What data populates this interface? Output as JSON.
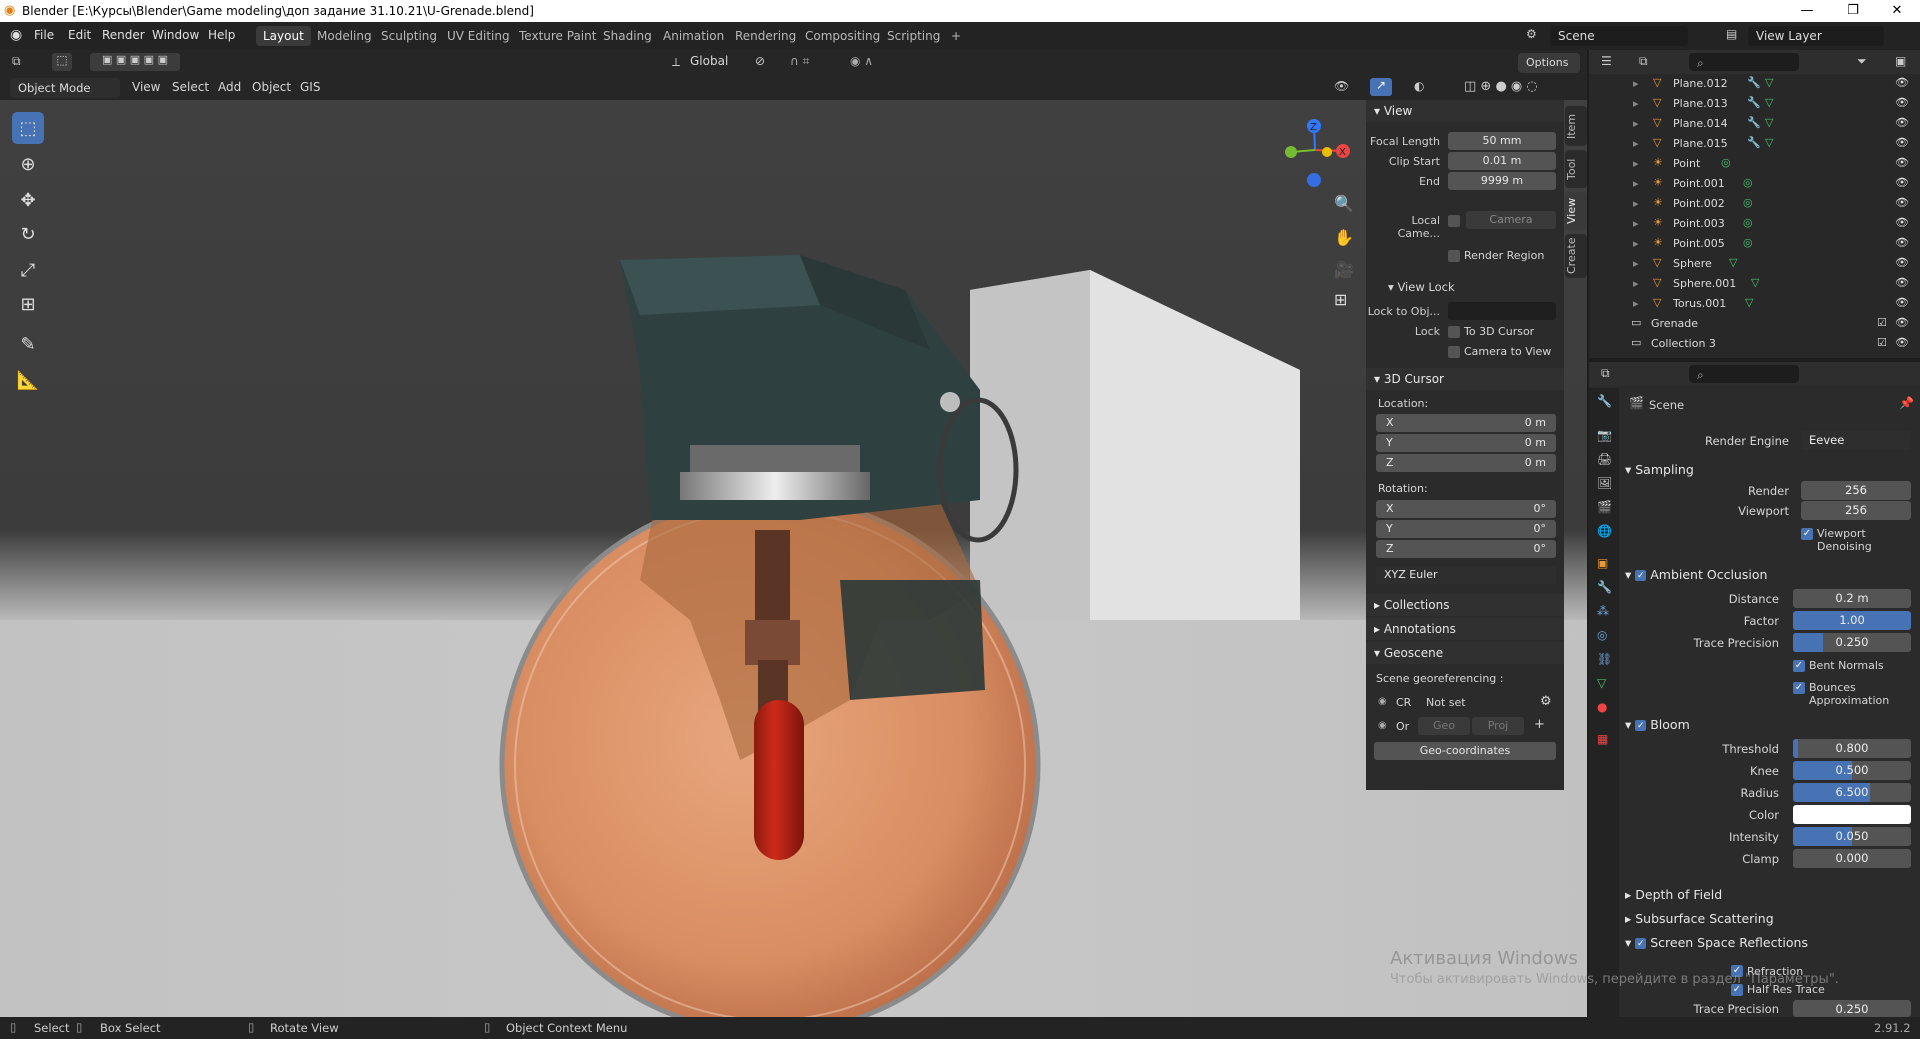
{
  "window": {
    "title": "Blender [E:\\Курсы\\Blender\\Game modeling\\доп задание 31.10.21\\U-Grenade.blend]",
    "minimize": "—",
    "maximize": "❐",
    "close": "✕"
  },
  "menus": [
    "File",
    "Edit",
    "Render",
    "Window",
    "Help"
  ],
  "workspaces": [
    "Layout",
    "Modeling",
    "Sculpting",
    "UV Editing",
    "Texture Paint",
    "Shading",
    "Animation",
    "Rendering",
    "Compositing",
    "Scripting"
  ],
  "workspace_add": "+",
  "scene": {
    "name": "Scene",
    "view_layer": "View Layer"
  },
  "viewport_header": {
    "transform": "Global",
    "options": "Options",
    "mode": "Object Mode",
    "menus": [
      "View",
      "Select",
      "Add",
      "Object",
      "GIS"
    ]
  },
  "npanel": {
    "tabs": [
      "Item",
      "Tool",
      "View",
      "Create"
    ],
    "view": {
      "title": "View",
      "focal_label": "Focal Length",
      "focal": "50 mm",
      "clip_start_label": "Clip Start",
      "clip_start": "0.01 m",
      "end_label": "End",
      "end": "9999 m",
      "local_cam_label": "Local Came...",
      "camera": "Camera",
      "render_region": "Render Region"
    },
    "view_lock": {
      "title": "View Lock",
      "lock_obj_label": "Lock to Obj...",
      "lock_label": "Lock",
      "to_cursor": "To 3D Cursor",
      "cam_to_view": "Camera to View"
    },
    "cursor": {
      "title": "3D Cursor",
      "location_label": "Location:",
      "loc": [
        {
          "axis": "X",
          "value": "0 m"
        },
        {
          "axis": "Y",
          "value": "0 m"
        },
        {
          "axis": "Z",
          "value": "0 m"
        }
      ],
      "rotation_label": "Rotation:",
      "rot": [
        {
          "axis": "X",
          "value": "0°"
        },
        {
          "axis": "Y",
          "value": "0°"
        },
        {
          "axis": "Z",
          "value": "0°"
        }
      ],
      "mode": "XYZ Euler"
    },
    "collections": "Collections",
    "annotations": "Annotations",
    "geoscene": {
      "title": "Geoscene",
      "georef": "Scene georeferencing :",
      "cr": "CR",
      "not_set": "Not set",
      "or": "Or",
      "geo": "Geo",
      "proj": "Proj",
      "geo_coords": "Geo-coordinates"
    }
  },
  "outliner": {
    "items": [
      {
        "name": "Plane.012",
        "type": "mesh"
      },
      {
        "name": "Plane.013",
        "type": "mesh"
      },
      {
        "name": "Plane.014",
        "type": "mesh"
      },
      {
        "name": "Plane.015",
        "type": "mesh"
      },
      {
        "name": "Point",
        "type": "light"
      },
      {
        "name": "Point.001",
        "type": "light"
      },
      {
        "name": "Point.002",
        "type": "light"
      },
      {
        "name": "Point.003",
        "type": "light"
      },
      {
        "name": "Point.005",
        "type": "light"
      },
      {
        "name": "Sphere",
        "type": "mesh"
      },
      {
        "name": "Sphere.001",
        "type": "mesh"
      },
      {
        "name": "Torus.001",
        "type": "mesh"
      }
    ],
    "collections": [
      "Grenade",
      "Collection 3"
    ]
  },
  "properties": {
    "scene_label": "Scene",
    "render_engine_label": "Render Engine",
    "render_engine": "Eevee",
    "sampling": {
      "title": "Sampling",
      "render_label": "Render",
      "render": "256",
      "viewport_label": "Viewport",
      "viewport": "256",
      "denoise": "Viewport Denoising"
    },
    "ao": {
      "title": "Ambient Occlusion",
      "distance_label": "Distance",
      "distance": "0.2 m",
      "factor_label": "Factor",
      "factor": "1.00",
      "factor_fill": 1.0,
      "trace_label": "Trace Precision",
      "trace": "0.250",
      "trace_fill": 0.25,
      "bent": "Bent Normals",
      "bounces": "Bounces Approximation"
    },
    "bloom": {
      "title": "Bloom",
      "threshold_label": "Threshold",
      "threshold": "0.800",
      "threshold_fill": 0.04,
      "knee_label": "Knee",
      "knee": "0.500",
      "knee_fill": 0.5,
      "radius_label": "Radius",
      "radius": "6.500",
      "radius_fill": 0.65,
      "color_label": "Color",
      "intensity_label": "Intensity",
      "intensity": "0.050",
      "intensity_fill": 0.5,
      "clamp_label": "Clamp",
      "clamp": "0.000"
    },
    "dof": "Depth of Field",
    "sss": "Subsurface Scattering",
    "ssr": {
      "title": "Screen Space Reflections",
      "refraction": "Refraction",
      "half_res": "Half Res Trace",
      "trace_label": "Trace Precision",
      "trace": "0.250"
    }
  },
  "activation": {
    "line1": "Активация Windows",
    "line2": "Чтобы активировать Windows, перейдите в раздел \"Параметры\"."
  },
  "statusbar": {
    "select": "Select",
    "box_select": "Box Select",
    "rotate": "Rotate View",
    "context": "Object Context Menu",
    "version": "2.91.2"
  },
  "gizmo": {
    "x": "X",
    "z": "Z"
  },
  "colors": {
    "accent": "#4772b3",
    "bg": "#1d1d1d",
    "panel": "#2b2b2b"
  }
}
